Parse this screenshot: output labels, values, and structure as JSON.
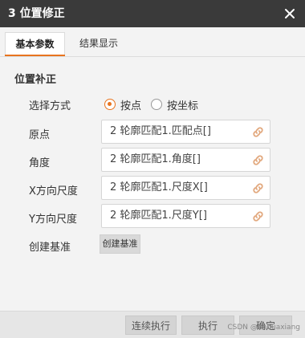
{
  "window": {
    "title": "3 位置修正",
    "close_icon": "close-icon"
  },
  "tabs": [
    {
      "label": "基本参数",
      "active": true
    },
    {
      "label": "结果显示",
      "active": false
    }
  ],
  "section_title": "位置补正",
  "select_mode": {
    "label": "选择方式",
    "options": [
      {
        "label": "按点",
        "checked": true
      },
      {
        "label": "按坐标",
        "checked": false
      }
    ]
  },
  "fields": [
    {
      "label": "原点",
      "value": "2 轮廓匹配1.匹配点[]",
      "icon": "link-icon"
    },
    {
      "label": "角度",
      "value": "2 轮廓匹配1.角度[]",
      "icon": "link-icon"
    },
    {
      "label": "X方向尺度",
      "value": "2 轮廓匹配1.尺度X[]",
      "icon": "link-icon"
    },
    {
      "label": "Y方向尺度",
      "value": "2 轮廓匹配1.尺度Y[]",
      "icon": "link-icon"
    }
  ],
  "create_base": {
    "label": "创建基准",
    "button": "创建基准"
  },
  "footer": {
    "continuous_run": "连续执行",
    "run": "执行",
    "ok": "确定"
  },
  "watermark": "CSDN @hhhuaxiang",
  "colors": {
    "accent": "#e8741f",
    "titlebar": "#3a3a3a",
    "link_icon": "#e2a97f"
  }
}
